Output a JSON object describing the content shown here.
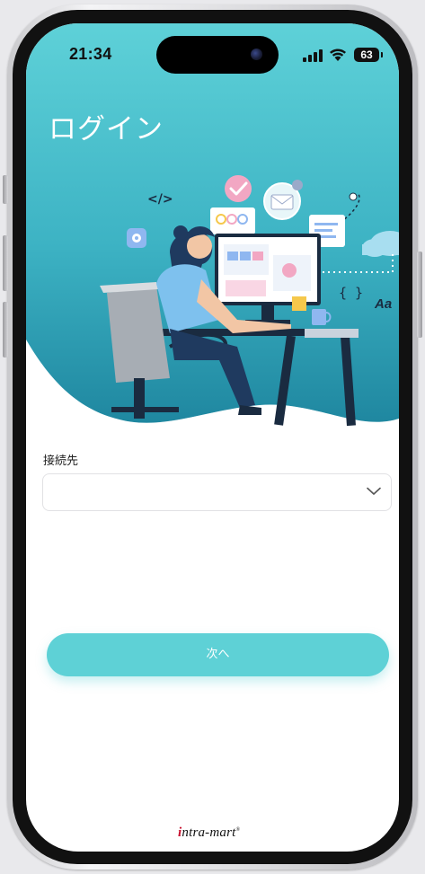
{
  "status_bar": {
    "time": "21:34",
    "battery": "63",
    "icons": [
      "signal-icon",
      "wifi-icon",
      "battery-icon"
    ]
  },
  "header": {
    "title": "ログイン"
  },
  "illustration": {
    "icons": [
      "code-icon",
      "check-icon",
      "email-icon",
      "gear-icon",
      "cloud-icon",
      "braces-icon"
    ],
    "code_glyph": "</>",
    "braces_glyph": "{ }",
    "font_glyph": "Aa"
  },
  "form": {
    "connection_label": "接続先",
    "connection_value": "",
    "next_button_label": "次へ"
  },
  "footer": {
    "brand_mark": "i",
    "brand_rest": "ntra-mart",
    "brand_reg": "®"
  },
  "colors": {
    "teal_light": "#5ed1d6",
    "teal_dark": "#1e8aa0",
    "button": "#5ed1d6"
  }
}
